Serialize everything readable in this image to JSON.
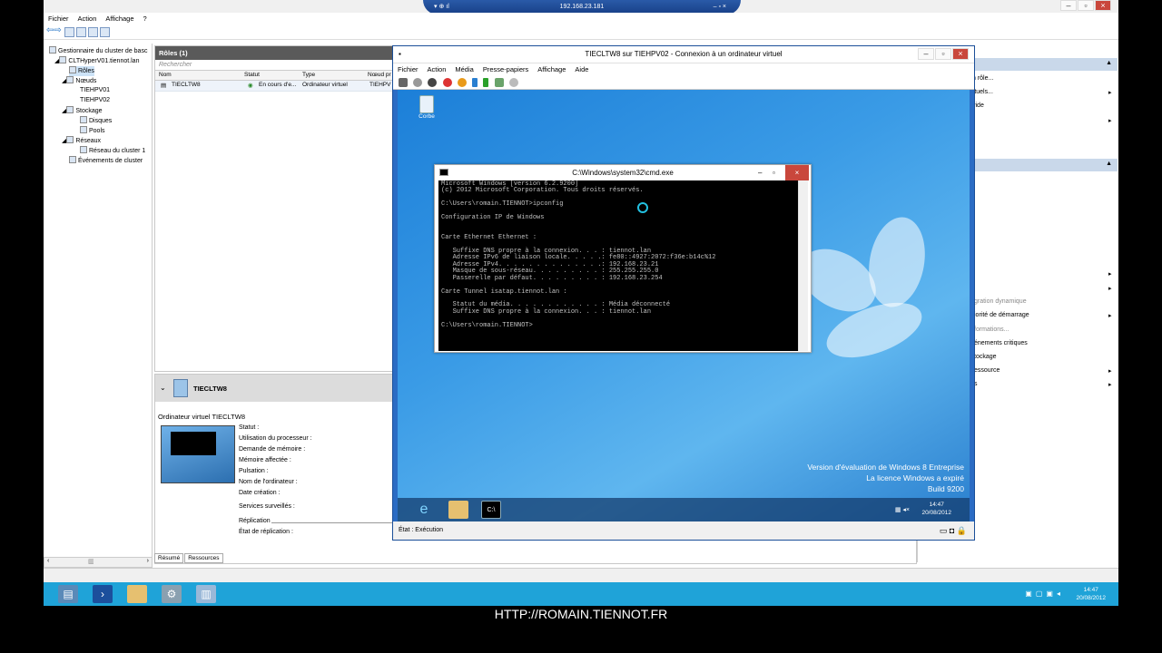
{
  "host": {
    "menu": [
      "Fichier",
      "Action",
      "Affichage",
      "?"
    ],
    "rdp_ip": "192.168.23.181"
  },
  "tree": {
    "items": [
      {
        "label": "Gestionnaire du cluster de basc"
      },
      {
        "label": "CLTHyperV01.tiennot.lan"
      },
      {
        "label": "Rôles"
      },
      {
        "label": "Nœuds"
      },
      {
        "label": "TIEHPV01"
      },
      {
        "label": "TIEHPV02"
      },
      {
        "label": "Stockage"
      },
      {
        "label": "Disques"
      },
      {
        "label": "Pools"
      },
      {
        "label": "Réseaux"
      },
      {
        "label": "Réseau du cluster 1"
      },
      {
        "label": "Événements de cluster"
      }
    ]
  },
  "roles": {
    "title": "Rôles (1)",
    "search_placeholder": "Rechercher",
    "columns": [
      "Nom",
      "Statut",
      "Type",
      "Nœud pr"
    ],
    "row": {
      "name": "TIECLTW8",
      "status": "En cours d'e...",
      "type": "Ordinateur virtuel",
      "node": "TIEHPV"
    }
  },
  "detail": {
    "header": "TIECLTW8",
    "subtitle": "Ordinateur virtuel TIECLTW8",
    "props": [
      "Statut :",
      "Utilisation du processeur :",
      "Demande de mémoire :",
      "Mémoire affectée :",
      "Pulsation :",
      "Nom de l'ordinateur :",
      "Date création :",
      "Services surveillés :",
      "Réplication",
      "État de réplication :"
    ],
    "tabs": [
      "Résumé",
      "Ressources"
    ]
  },
  "actions": {
    "items": [
      "n rôle...",
      "rtuels...",
      "vide",
      "gration dynamique",
      "iorité de démarrage",
      "formations...",
      "énements critiques",
      "tockage",
      "essource",
      "s"
    ]
  },
  "vm": {
    "title": "TIECLTW8 sur TIEHPV02 - Connexion à un ordinateur virtuel",
    "menu": [
      "Fichier",
      "Action",
      "Média",
      "Presse-papiers",
      "Affichage",
      "Aide"
    ],
    "status": "État : Exécution",
    "recycle_label": "Corbe",
    "watermark": [
      "Version d'évaluation de Windows 8 Entreprise",
      "La licence Windows a expiré",
      "Build 9200"
    ],
    "guest_time": "14:47",
    "guest_date": "20/08/2012"
  },
  "cmd": {
    "title": "C:\\Windows\\system32\\cmd.exe",
    "text": "Microsoft Windows [version 6.2.9200]\n(c) 2012 Microsoft Corporation. Tous droits réservés.\n\nC:\\Users\\romain.TIENNOT>ipconfig\n\nConfiguration IP de Windows\n\n\nCarte Ethernet Ethernet :\n\n   Suffixe DNS propre à la connexion. . . : tiennot.lan\n   Adresse IPv6 de liaison locale. . . . .: fe80::4927:2072:f36e:b14c%12\n   Adresse IPv4. . . . . . . . . . . . . .: 192.168.23.21\n   Masque de sous-réseau. . . . . . . . . : 255.255.255.0\n   Passerelle par défaut. . . . . . . . . : 192.168.23.254\n\nCarte Tunnel isatap.tiennot.lan :\n\n   Statut du média. . . . . . . . . . . . : Média déconnecté\n   Suffixe DNS propre à la connexion. . . : tiennot.lan\n\nC:\\Users\\romain.TIENNOT>"
  },
  "taskbar": {
    "time": "14:47",
    "date": "20/08/2012"
  },
  "footer": "HTTP://ROMAIN.TIENNOT.FR"
}
